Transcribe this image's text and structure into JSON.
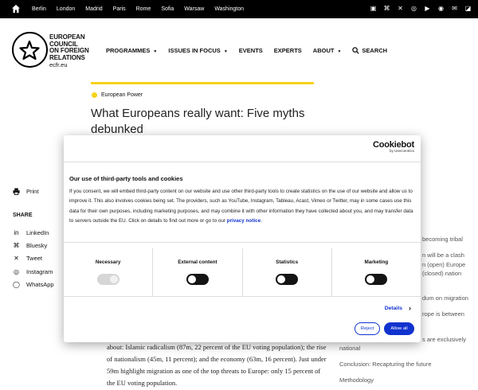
{
  "topbar": {
    "cities": [
      "Berlin",
      "London",
      "Madrid",
      "Paris",
      "Rome",
      "Sofia",
      "Warsaw",
      "Washington"
    ],
    "social_icons": [
      "linkedin-icon",
      "bluesky-icon",
      "x-icon",
      "instagram-icon",
      "youtube-icon",
      "podcast-icon",
      "mail-icon",
      "rss-icon"
    ]
  },
  "header": {
    "logo_lines": [
      "EUROPEAN",
      "COUNCIL",
      "ON FOREIGN",
      "RELATIONS"
    ],
    "logo_url": "ecfr.eu",
    "nav": [
      {
        "label": "PROGRAMMES",
        "has_caret": true
      },
      {
        "label": "ISSUES IN FOCUS",
        "has_caret": true
      },
      {
        "label": "EVENTS",
        "has_caret": false
      },
      {
        "label": "EXPERTS",
        "has_caret": false
      },
      {
        "label": "ABOUT",
        "has_caret": true
      }
    ],
    "search_label": "SEARCH"
  },
  "article": {
    "tag": "European Power",
    "title": "What Europeans really want: Five myths debunked",
    "body": "about: Islamic radicalism (87m, 22 percent of the EU voting population); the rise of nationalism (45m, 11 percent); and the economy (63m, 16 percent). Just under 59m highlight migration as one of the top threats to Europe: only 15 percent of the EU voting population."
  },
  "sidebar": {
    "print_label": "Print",
    "share_heading": "SHARE",
    "share_items": [
      {
        "label": "LinkedIn",
        "icon": "linkedin-icon"
      },
      {
        "label": "Bluesky",
        "icon": "bluesky-icon"
      },
      {
        "label": "Tweet",
        "icon": "x-icon"
      },
      {
        "label": "Instagram",
        "icon": "instagram-icon"
      },
      {
        "label": "WhatsApp",
        "icon": "whatsapp-icon"
      }
    ]
  },
  "toc": {
    "fragments": [
      "becoming tribal",
      "n will be a clash",
      "n (open) Europe",
      "(closed) nation",
      "dum on migration",
      "rope is between",
      "s are exclusively"
    ],
    "national": "national",
    "conclusion": "Conclusion: Recapturing the future",
    "methodology": "Methodology"
  },
  "cookie": {
    "brand": "Cookiebot",
    "brand_sub": "by Usercentrics",
    "title": "Our use of third-party tools and cookies",
    "body": "If you consent, we will embed third-party content on our website and use other third-party tools to create statistics on the use of our website and allow us to improve it. This also involves cookies being set. The providers, such as YouTube, Instagram, Tableau, Acast, Vimeo  or Twitter, may in some cases use this data for their own purposes, including marketing purposes, and may combine it with other information they have collected about you, and may transfer data to servers outside the EU. Click on details to find out more or go to our",
    "privacy_link": "privacy notice",
    "categories": [
      {
        "label": "Necessary",
        "state": "disabled"
      },
      {
        "label": "External content",
        "state": "off"
      },
      {
        "label": "Statistics",
        "state": "off"
      },
      {
        "label": "Marketing",
        "state": "off"
      }
    ],
    "details_label": "Details",
    "reject_label": "Reject",
    "allow_label": "Allow all"
  }
}
